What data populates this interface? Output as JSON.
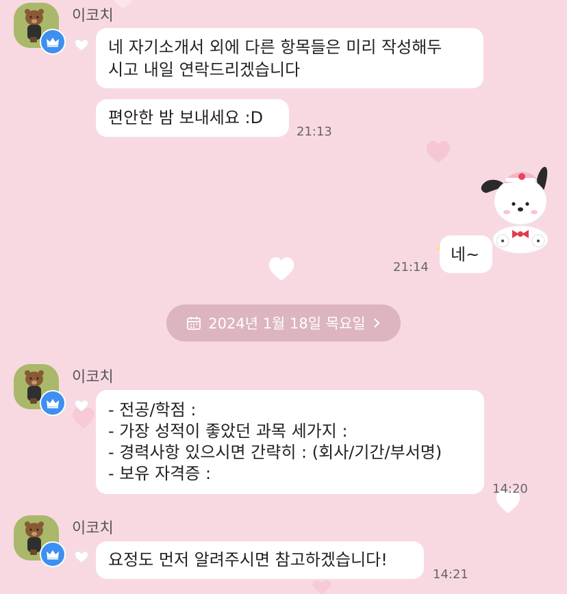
{
  "chat": {
    "sender_name": "이코치",
    "date_divider": "2024년 1월 18일 목요일",
    "messages": [
      {
        "text": "네 자기소개서 외에 다른 항목들은 미리 작성해두\n시고 내일 연락드리겠습니다"
      },
      {
        "text": "편안한 밤 보내세요 :D",
        "time": "21:13"
      },
      {
        "text": "네~",
        "time": "21:14"
      },
      {
        "text": "- 전공/학점 :\n- 가장 성적이 좋았던 과목 세가지 :\n- 경력사항 있으시면 간략히 : (회사/기간/부서명)\n- 보유 자격증 :",
        "time": "14:20"
      },
      {
        "text": "요정도 먼저 알려주시면 참고하겠습니다!",
        "time": "14:21"
      }
    ]
  },
  "colors": {
    "background": "#f8d9e2",
    "bubble": "#ffffff",
    "badge": "#3d8ff2",
    "date_pill": "#dcb5c0"
  },
  "icons": {
    "avatar": "bear-avatar",
    "badge": "crown-icon",
    "like": "heart-outline-icon",
    "sticker": "pochacco-sticker",
    "calendar": "calendar-icon",
    "chevron": "chevron-right-icon"
  }
}
